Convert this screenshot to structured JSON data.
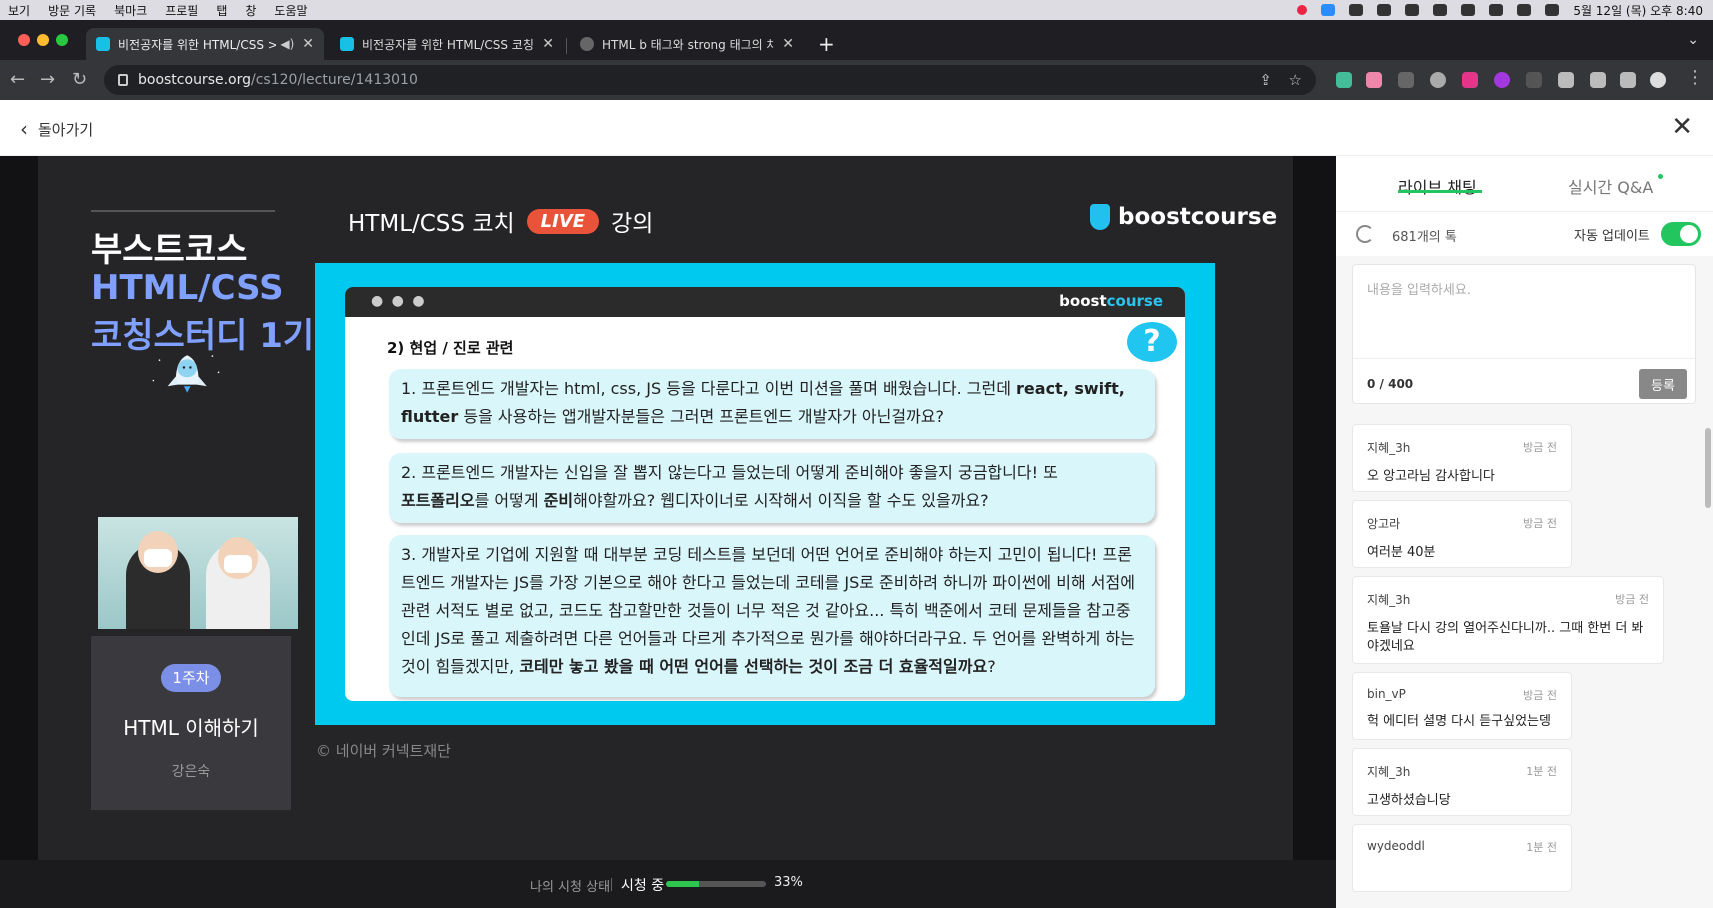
{
  "menubar": {
    "items": [
      "보기",
      "방문 기록",
      "북마크",
      "프로필",
      "탭",
      "창",
      "도움말"
    ],
    "clock": "5월 12일 (목) 오후 8:40"
  },
  "tabs": [
    {
      "title": "비전공자를 위한 HTML/CSS >"
    },
    {
      "title": "비전공자를 위한 HTML/CSS 코칭스터디"
    },
    {
      "title": "HTML b 태그와 strong 태그의 차이"
    }
  ],
  "address": {
    "domain": "boostcourse.org",
    "path": "/cs120/lecture/1413010"
  },
  "header": {
    "back_label": "돌아가기"
  },
  "slide": {
    "side_title_1": "부스트코스",
    "side_title_2": "HTML/CSS",
    "side_title_3": "코칭스터디 1기",
    "week_badge": "1주차",
    "week_title": "HTML 이해하기",
    "week_author": "강은숙",
    "head_left": "HTML/CSS 코치",
    "live_badge": "LIVE",
    "head_right": "강의",
    "logo": "boostcourse",
    "window_brand_a": "boost",
    "window_brand_b": "course",
    "window_dots": "● ● ●",
    "qmark": "?",
    "section_title": "2) 현업 / 진로 관련",
    "q1_a": "1. 프론트엔드 개발자는 html, css, JS 등을 다룬다고 이번 미션을 풀며 배웠습니다. 그런데 ",
    "q1_b": "react, swift,",
    "q1_c": "flutter",
    "q1_d": " 등을 사용하는 앱개발자분들은 그러면 프론트엔드 개발자가 아닌걸까요?",
    "q2_a": "2. 프론트엔드 개발자는 신입을 잘 뽑지 않는다고 들었는데 어떻게 준비해야 좋을지 궁금합니다! 또",
    "q2_b": "포트폴리오",
    "q2_c": "를 어떻게 ",
    "q2_d": "준비",
    "q2_e": "해야할까요? 웹디자이너로 시작해서 이직을 할 수도 있을까요?",
    "q3_a": "3. 개발자로 기업에 지원할 때 대부분 코딩 테스트를 보던데 어떤 언어로 준비해야 하는지 고민이 됩니다! 프론트엔드 개발자는 JS를 가장 기본으로 해야 한다고 들었는데 코테를 JS로 준비하려 하니까 파이썬에 비해 서점에 관련 서적도 별로 없고, 코드도 참고할만한 것들이 너무 적은 것 같아요... 특히 백준에서 코테 문제들을 참고중인데 JS로 풀고 제출하려면 다른 언어들과 다르게 추가적으로 뭔가를 해야하더라구요.  두 언어를 완벽하게 하는 것이 힘들겠지만, ",
    "q3_b": "코테만 놓고 봤을 때 어떤 언어를 선택하는 것이 조금 더 효율적일까요",
    "q3_c": "?",
    "copyright": "© 네이버 커넥트재단"
  },
  "status": {
    "label": "나의 시청 상태",
    "value": "시청 중",
    "progress": 0.33,
    "percent": "33%"
  },
  "chat": {
    "tab_live": "라이브 채팅",
    "tab_qa": "실시간 Q&A",
    "count": "681개의 톡",
    "auto_update": "자동 업데이트",
    "placeholder": "내용을 입력하세요.",
    "charcount": "0 / 400",
    "submit": "등록",
    "messages": [
      {
        "user": "지혜_3h",
        "time": "방금 전",
        "text": "오 앙고라님 감사합니다"
      },
      {
        "user": "앙고라",
        "time": "방금 전",
        "text": "여러분 40분"
      },
      {
        "user": "지혜_3h",
        "time": "방금 전",
        "text": "토욜날 다시 강의 열어주신다니까.. 그때 한번 더 봐야겠네요"
      },
      {
        "user": "bin_vP",
        "time": "방금 전",
        "text": "헉 에디터 셜명 다시 듣구싶었는뎅"
      },
      {
        "user": "지혜_3h",
        "time": "1분 전",
        "text": "고생하셨습니당"
      },
      {
        "user": "wydeoddl",
        "time": "1분 전",
        "text": ""
      }
    ]
  },
  "colors": {
    "accent_green": "#22c55e",
    "brand_cyan": "#00c9f0",
    "live_red": "#e9533a"
  }
}
